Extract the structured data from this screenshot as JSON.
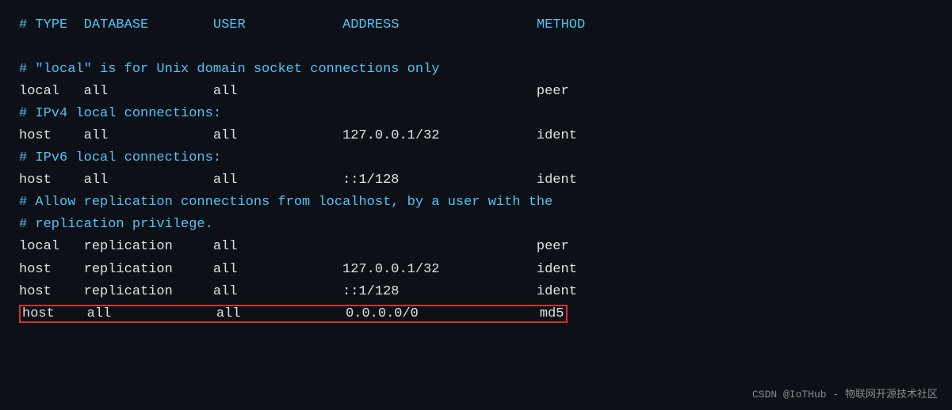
{
  "header": {
    "hash": "#",
    "type": "TYPE",
    "database": "DATABASE",
    "user": "USER",
    "address": "ADDRESS",
    "method": "METHOD"
  },
  "lines": [
    {
      "type": "comment",
      "text": "# \"local\" is for Unix domain socket connections only"
    },
    {
      "type": "data",
      "cols": [
        "local",
        "all",
        "",
        "all",
        "",
        "peer"
      ]
    },
    {
      "type": "comment",
      "text": "# IPv4 local connections:"
    },
    {
      "type": "data",
      "cols": [
        "host",
        "all",
        "",
        "all",
        "127.0.0.1/32",
        "ident"
      ]
    },
    {
      "type": "comment",
      "text": "# IPv6 local connections:"
    },
    {
      "type": "data",
      "cols": [
        "host",
        "all",
        "",
        "all",
        "::1/128",
        "ident"
      ]
    },
    {
      "type": "comment",
      "text": "# Allow replication connections from localhost, by a user with the"
    },
    {
      "type": "comment",
      "text": "# replication privilege."
    },
    {
      "type": "data",
      "cols": [
        "local",
        "replication",
        "",
        "all",
        "",
        "peer"
      ]
    },
    {
      "type": "data",
      "cols": [
        "host",
        "replication",
        "",
        "all",
        "127.0.0.1/32",
        "ident"
      ]
    },
    {
      "type": "data",
      "cols": [
        "host",
        "replication",
        "",
        "all",
        "::1/128",
        "ident"
      ]
    },
    {
      "type": "data-highlight",
      "cols": [
        "host",
        "all",
        "",
        "all",
        "0.0.0.0/0",
        "md5"
      ]
    }
  ],
  "watermark": "CSDN @IoTHub - 物联网开源技术社区"
}
